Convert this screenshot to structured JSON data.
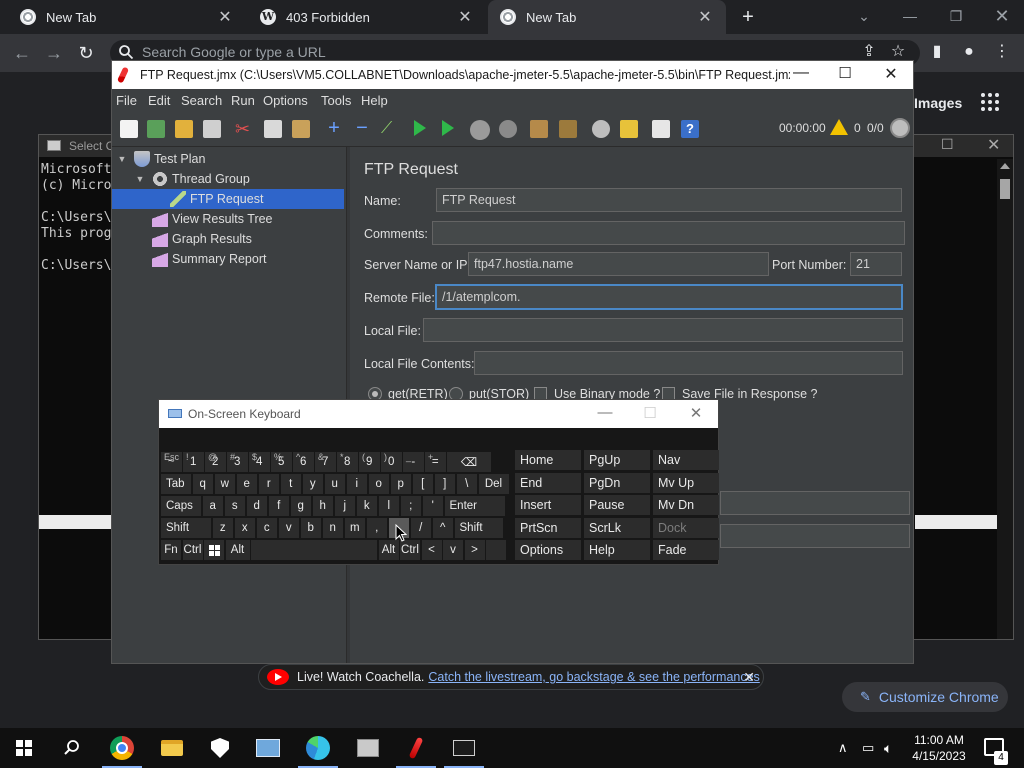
{
  "browser": {
    "tabs": [
      {
        "title": "New Tab"
      },
      {
        "title": "403 Forbidden"
      },
      {
        "title": "New Tab"
      }
    ],
    "omnibox_placeholder": "Search Google or type a URL",
    "images_link": "Images",
    "customize_label": "Customize Chrome",
    "promo": {
      "lead": "Live! Watch Coachella.",
      "link": "Catch the livestream, go backstage & see the performances"
    }
  },
  "cmd": {
    "title": "Select C",
    "lines": [
      "Microsoft",
      "(c) Micro",
      "",
      "C:\\Users\\",
      "This prog",
      "",
      "C:\\Users\\"
    ]
  },
  "jmeter": {
    "title": "FTP Request.jmx (C:\\Users\\VM5.COLLABNET\\Downloads\\apache-jmeter-5.5\\apache-jmeter-5.5\\bin\\FTP Request.jmx) ...",
    "menu": [
      "File",
      "Edit",
      "Search",
      "Run",
      "Options",
      "Tools",
      "Help"
    ],
    "timer": "00:00:00",
    "warnings": "0",
    "threads": "0/0",
    "tree": [
      "Test Plan",
      "Thread Group",
      "FTP Request",
      "View Results Tree",
      "Graph Results",
      "Summary Report"
    ],
    "form": {
      "title": "FTP Request",
      "name_label": "Name:",
      "name_value": "FTP Request",
      "comments_label": "Comments:",
      "comments_value": "",
      "server_label": "Server Name or IP:",
      "server_value": "ftp47.hostia.name",
      "port_label": "Port Number:",
      "port_value": "21",
      "remote_label": "Remote File:",
      "remote_value": "/1/atemplcom.",
      "local_label": "Local File:",
      "local_value": "",
      "contents_label": "Local File Contents:",
      "contents_value": "",
      "get_label": "get(RETR)",
      "put_label": "put(STOR)",
      "binary_label": "Use Binary mode ?",
      "save_label": "Save File in Response ?"
    }
  },
  "osk": {
    "title": "On-Screen Keyboard",
    "rows": {
      "r1": [
        {
          "k": "~",
          "s": "Esc"
        },
        {
          "k": "1",
          "s": "!"
        },
        {
          "k": "2",
          "s": "@"
        },
        {
          "k": "3",
          "s": "#"
        },
        {
          "k": "4",
          "s": "$"
        },
        {
          "k": "5",
          "s": "%"
        },
        {
          "k": "6",
          "s": "^"
        },
        {
          "k": "7",
          "s": "&"
        },
        {
          "k": "8",
          "s": "*"
        },
        {
          "k": "9",
          "s": "("
        },
        {
          "k": "0",
          "s": ")"
        },
        {
          "k": "-",
          "s": "_"
        },
        {
          "k": "=",
          "s": "+"
        },
        {
          "k": "⌫",
          "s": ""
        }
      ],
      "r2": [
        "Tab",
        "q",
        "w",
        "e",
        "r",
        "t",
        "y",
        "u",
        "i",
        "o",
        "p",
        "[",
        "]",
        "\\",
        "Del"
      ],
      "r3": [
        "Caps",
        "a",
        "s",
        "d",
        "f",
        "g",
        "h",
        "j",
        "k",
        "l",
        ";",
        "'",
        "Enter"
      ],
      "r4": [
        "Shift",
        "z",
        "x",
        "c",
        "v",
        "b",
        "n",
        "m",
        ",",
        ".",
        "/",
        "^",
        "Shift"
      ],
      "r5": [
        "Fn",
        "Ctrl",
        "",
        "Alt",
        "",
        "Alt",
        "Ctrl",
        "<",
        "v",
        ">",
        ""
      ]
    },
    "side": [
      [
        "Home",
        "PgUp",
        "Nav"
      ],
      [
        "End",
        "PgDn",
        "Mv Up"
      ],
      [
        "Insert",
        "Pause",
        "Mv Dn"
      ],
      [
        "PrtScn",
        "ScrLk",
        "Dock"
      ],
      [
        "Options",
        "Help",
        "Fade"
      ]
    ]
  },
  "taskbar": {
    "time": "11:00 AM",
    "date": "4/15/2023",
    "notifications": "4"
  }
}
